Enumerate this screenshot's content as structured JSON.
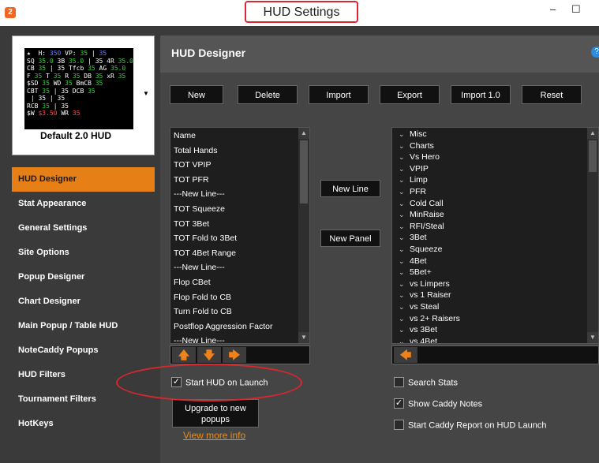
{
  "window": {
    "title": "HUD Settings",
    "app_icon": "2",
    "minimize_glyph": "–",
    "maximize_glyph": "☐"
  },
  "preview": {
    "label": "Default 2.0 HUD",
    "dropdown_glyph": "▼"
  },
  "sidebar": {
    "items": [
      {
        "label": "HUD Designer",
        "active": true
      },
      {
        "label": "Stat Appearance"
      },
      {
        "label": "General Settings"
      },
      {
        "label": "Site Options"
      },
      {
        "label": "Popup Designer"
      },
      {
        "label": "Chart Designer"
      },
      {
        "label": "Main Popup / Table HUD"
      },
      {
        "label": "NoteCaddy Popups"
      },
      {
        "label": "HUD Filters"
      },
      {
        "label": "Tournament Filters"
      },
      {
        "label": "HotKeys"
      }
    ]
  },
  "panel": {
    "title": "HUD Designer",
    "help_glyph": "?",
    "toolbar": {
      "new": "New",
      "delete": "Delete",
      "import": "Import",
      "export": "Export",
      "import10": "Import 1.0",
      "reset": "Reset"
    },
    "stats_list": [
      "Name",
      "Total Hands",
      "TOT VPIP",
      "TOT PFR",
      "---New Line---",
      "TOT Squeeze",
      "TOT 3Bet",
      "TOT Fold to 3Bet",
      "TOT 4Bet Range",
      "---New Line---",
      "Flop CBet",
      "Flop Fold to CB",
      "Turn Fold to CB",
      "Postflop Aggression Factor",
      "---New Line---"
    ],
    "mid_buttons": {
      "new_line": "New Line",
      "new_panel": "New Panel"
    },
    "category_list": [
      "Misc",
      "Charts",
      "Vs Hero",
      "VPIP",
      "Limp",
      "PFR",
      "Cold Call",
      "MinRaise",
      "RFI/Steal",
      "3Bet",
      "Squeeze",
      "4Bet",
      "5Bet+",
      "vs Limpers",
      "vs 1 Raiser",
      "vs Steal",
      "vs 2+ Raisers",
      "vs 3Bet",
      "vs 4Bet"
    ],
    "arrows": {
      "up": "🡅",
      "down": "🡇",
      "right": "🡆",
      "left": "🡄"
    },
    "checkboxes": {
      "start_hud": {
        "label": "Start HUD on Launch",
        "checked": true
      },
      "search_stats": {
        "label": "Search Stats",
        "checked": false
      },
      "show_caddy": {
        "label": "Show Caddy Notes",
        "checked": true
      },
      "start_caddy_report": {
        "label": "Start Caddy Report on HUD Launch",
        "checked": false
      }
    },
    "upgrade_button": "Upgrade to new popups",
    "view_more": "View more info"
  },
  "colors": {
    "accent": "#e57f16",
    "annotation_red": "#d9272e"
  }
}
